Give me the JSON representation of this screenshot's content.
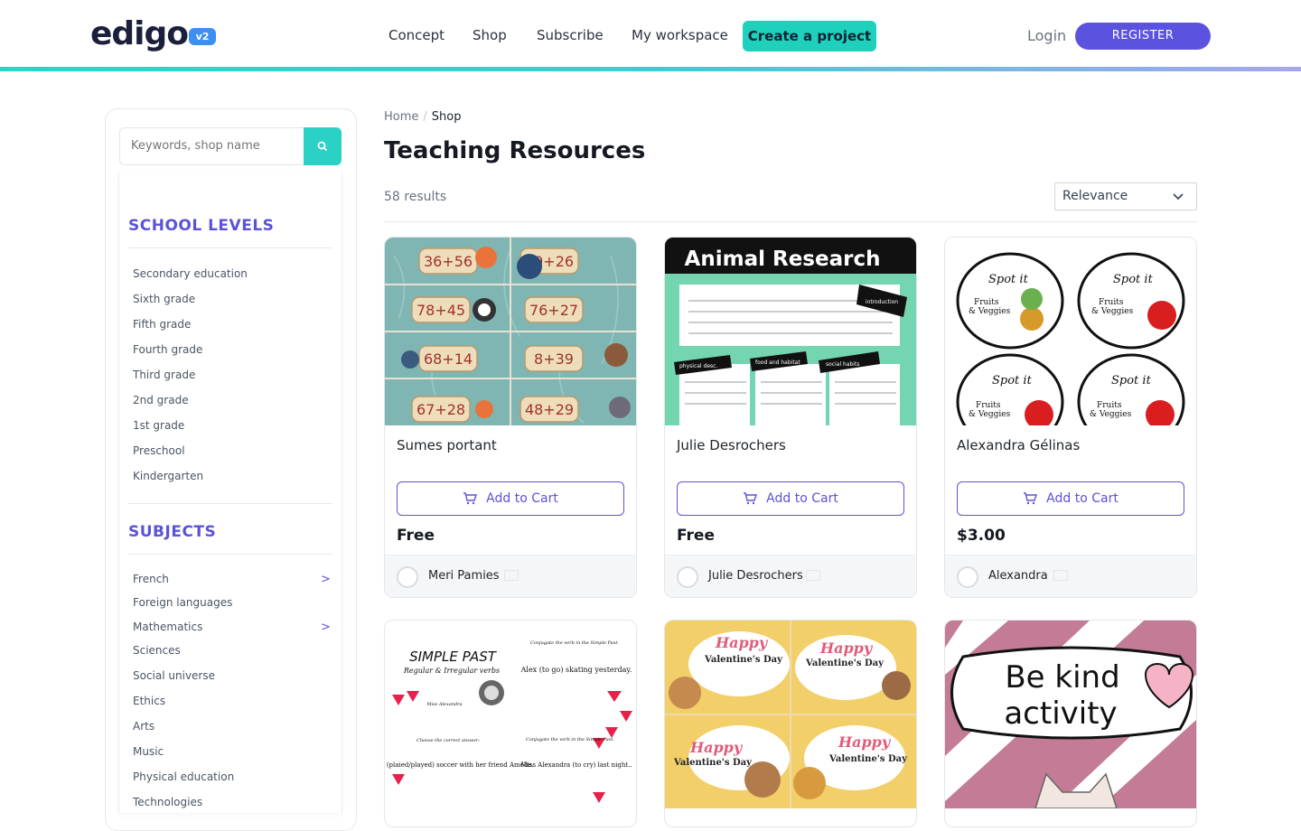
{
  "header": {
    "logo_text": "edigo",
    "logo_badge": "v2",
    "nav": [
      "Concept",
      "Shop",
      "Subscribe",
      "My workspace"
    ],
    "create_button": "Create a project",
    "login": "Login",
    "register": "REGISTER"
  },
  "search": {
    "placeholder": "Keywords, shop name",
    "icon": "search-icon"
  },
  "sidebar": {
    "school_levels_title": "SCHOOL LEVELS",
    "school_levels": [
      "Secondary education",
      "Sixth grade",
      "Fifth grade",
      "Fourth grade",
      "Third grade",
      "2nd grade",
      "1st grade",
      "Preschool",
      "Kindergarten"
    ],
    "subjects_title": "SUBJECTS",
    "subjects": [
      "French",
      "Foreign languages",
      "Mathematics",
      "Sciences",
      "Social universe",
      "Ethics",
      "Arts",
      "Music",
      "Physical education",
      "Technologies"
    ],
    "subject_arrow": ">"
  },
  "breadcrumb": {
    "home": "Home",
    "sep": "/",
    "current": "Shop"
  },
  "page": {
    "title": "Teaching Resources",
    "results": "58 results",
    "sort": "Relevance"
  },
  "products": [
    {
      "title": "Sumes portant",
      "price": "Free",
      "author": "Meri Pamies",
      "cart": "Add to Cart"
    },
    {
      "title": "Julie Desrochers",
      "price": "Free",
      "author": "Julie Desrochers",
      "cart": "Add to Cart"
    },
    {
      "title": "Alexandra Gélinas",
      "price": "$3.00",
      "author": "Alexandra",
      "cart": "Add to Cart"
    }
  ],
  "thumbs": {
    "t1": [
      "36+56",
      "89+26",
      "78+45",
      "76+27",
      "68+14",
      "8+39",
      "67+28",
      "48+29"
    ],
    "t2": {
      "title": "Animal Research",
      "tabs": [
        "physical desc.",
        "food and habitat",
        "social habits"
      ],
      "intro": "introduction"
    },
    "t3": {
      "label1": "Spot it",
      "label2": "Fruits",
      "label3": "& Veggies"
    },
    "t4": {
      "title": "SIMPLE PAST",
      "subtitle": "Regular & Irregular verbs",
      "q1": "Conjugate the verb in the Simple Past.",
      "a1": "Alex (to go) skating yesterday.",
      "q2": "Choose the correct answer:",
      "a2": "Maddy (plaied/played) soccer with her friend Amélie.",
      "q3": "Conjugate the verb in the Simple Past.",
      "a3": "Miss Alexandra (to cry) last night..",
      "sig": "Miss Alexandra"
    },
    "t5": {
      "word1": "Happy",
      "word2": "Valentine's Day"
    },
    "t6": {
      "line1": "Be kind",
      "line2": "activity"
    }
  },
  "colors": {
    "accent": "#5b53d6",
    "teal": "#1fd1bd",
    "register": "#5b53e0"
  }
}
